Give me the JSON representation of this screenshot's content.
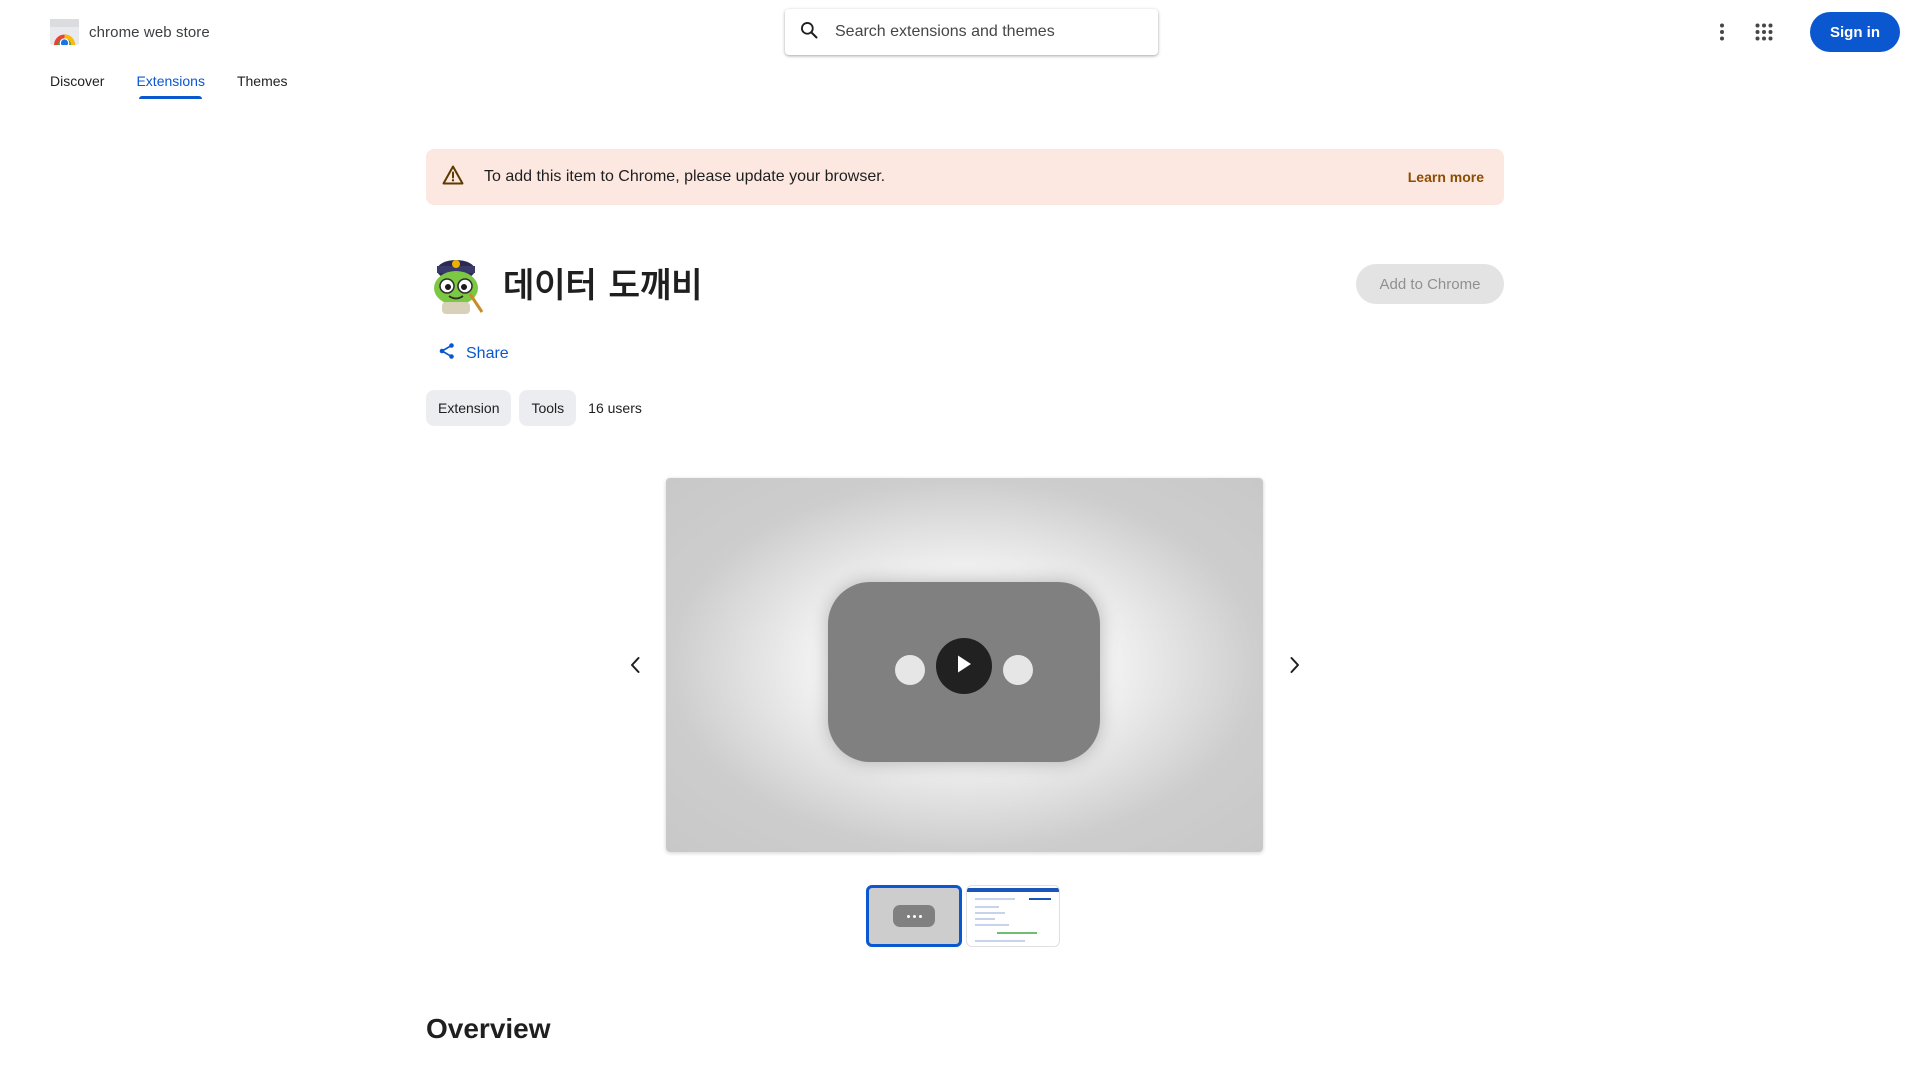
{
  "header": {
    "logo_text": "chrome web store",
    "search_placeholder": "Search extensions and themes",
    "signin_label": "Sign in"
  },
  "nav": {
    "tabs": [
      {
        "label": "Discover"
      },
      {
        "label": "Extensions",
        "active": true
      },
      {
        "label": "Themes"
      }
    ]
  },
  "banner": {
    "message": "To add this item to Chrome, please update your browser.",
    "link": "Learn more"
  },
  "item": {
    "title": "데이터 도깨비",
    "add_label": "Add to Chrome",
    "share_label": "Share",
    "chips": [
      "Extension",
      "Tools"
    ],
    "users": "16 users"
  },
  "media": {
    "thumbnail_count": 2,
    "selected_thumbnail": 1
  },
  "section": {
    "overview_title": "Overview"
  },
  "colors": {
    "accent": "#0b57d0",
    "banner_bg": "#fce8e0",
    "banner_link": "#8c4d00",
    "chip_bg": "#ecedf0"
  }
}
